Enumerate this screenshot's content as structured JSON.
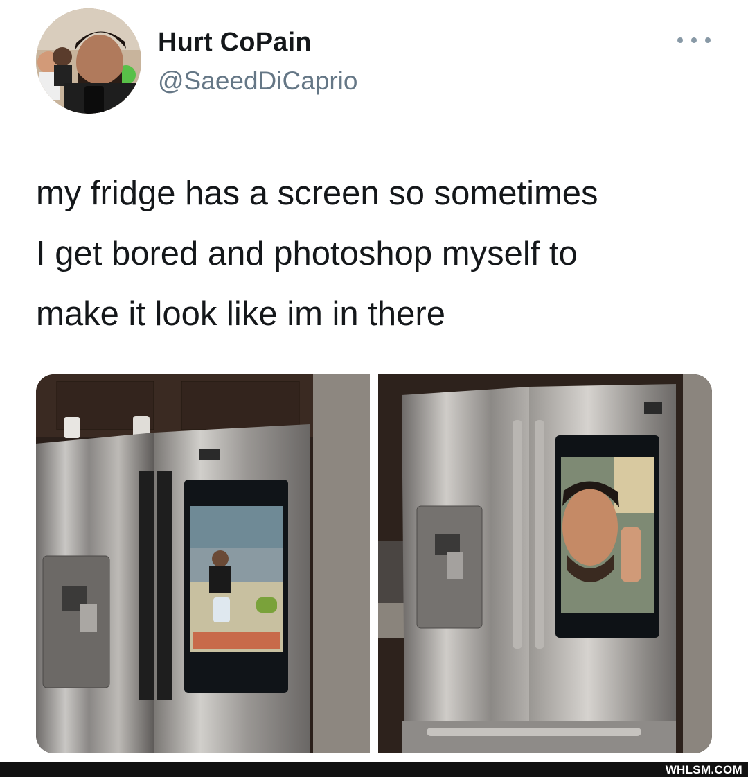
{
  "tweet": {
    "author_name": "Hurt CoPain",
    "author_handle": "@SaeedDiCaprio",
    "text_lines": [
      "my fridge has a screen so sometimes",
      "I get bored and photoshop myself to",
      "make it look like im in there"
    ],
    "more_icon": "ellipsis-icon",
    "media": [
      {
        "kind": "photo",
        "subject": "fridge-left-photo"
      },
      {
        "kind": "photo",
        "subject": "fridge-right-photo"
      }
    ]
  },
  "watermark": "WHLSM.COM"
}
